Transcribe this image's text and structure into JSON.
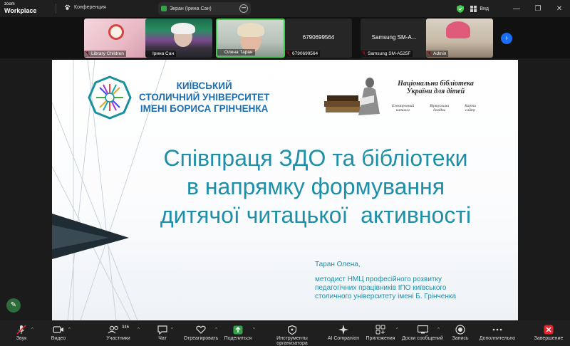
{
  "app": {
    "logo_line1": "zoom",
    "logo_line2": "Workplace"
  },
  "titlebar": {
    "conference_label": "Конференция",
    "screen_label": "Экран (Ірина Сан)",
    "view_label": "Вид",
    "more_symbol": "•••"
  },
  "participants": [
    {
      "name": "Library Children",
      "muted": true
    },
    {
      "name": "Ірина Сан",
      "muted": false
    },
    {
      "name": "Олена Таран",
      "muted": false,
      "speaking": true
    },
    {
      "name": "6790699564",
      "big": "6790699564",
      "muted": true
    },
    {
      "name": "Samsung SM-A525F",
      "big": "Samsung SM-A...",
      "muted": true
    },
    {
      "name": "Admin",
      "muted": true
    }
  ],
  "slide": {
    "university": [
      "КИЇВСЬКИЙ",
      "СТОЛИЧНИЙ УНІВЕРСИТЕТ",
      "ІМЕНІ БОРИСА ГРІНЧЕНКА"
    ],
    "library_title": [
      "Національна бібліотека",
      "України для дітей"
    ],
    "library_links": [
      [
        "Електронний",
        "каталог"
      ],
      [
        "Віртуальна",
        "довідка"
      ],
      [
        "Карта",
        "сайту"
      ]
    ],
    "title_lines": [
      "Співпраця ЗДО та бібліотеки",
      "в напрямку формування",
      "дитячої читацької  активності"
    ],
    "author_name": "Таран Олена,",
    "author_position": [
      "методист НМЦ професійного розвитку",
      "педагогічних працівників ІПО київського",
      "столичного університету імені Б. Грінченка"
    ]
  },
  "toolbar": {
    "participant_count": "346",
    "buttons": [
      {
        "label": "Звук",
        "icon": "mic-muted-icon"
      },
      {
        "label": "Видео",
        "icon": "camera-icon"
      },
      {
        "label": "Участники",
        "icon": "people-icon"
      },
      {
        "label": "Чат",
        "icon": "chat-icon"
      },
      {
        "label": "Отреагировать",
        "icon": "heart-icon"
      },
      {
        "label": "Поделиться",
        "icon": "share-icon"
      },
      {
        "label": "Инструменты организатора",
        "icon": "shield-icon"
      },
      {
        "label": "AI Companion",
        "icon": "sparkle-icon"
      },
      {
        "label": "Приложения",
        "icon": "apps-icon"
      },
      {
        "label": "Доски сообщений",
        "icon": "whiteboard-icon"
      },
      {
        "label": "Запись",
        "icon": "record-icon"
      },
      {
        "label": "Дополнительно",
        "icon": "more-icon"
      },
      {
        "label": "Завершение",
        "icon": "end-icon"
      }
    ]
  },
  "colors": {
    "accent_green": "#3fc94e",
    "share_green": "#35a34a",
    "end_red": "#e5242b",
    "title_teal": "#1e8fa8",
    "university_blue": "#1f6fb0"
  }
}
